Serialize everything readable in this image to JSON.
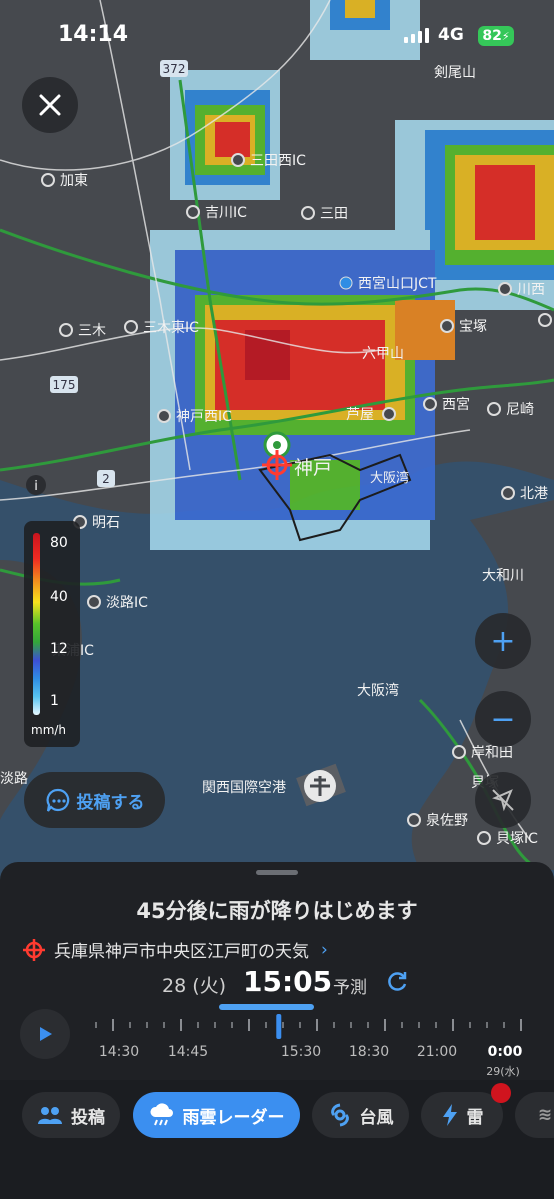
{
  "status_bar": {
    "time": "14:14",
    "network": "4G",
    "battery": "82"
  },
  "map": {
    "place_labels": [
      {
        "id": "kenbisan",
        "text": "剣尾山"
      },
      {
        "id": "sandanishi",
        "text": "三田西IC"
      },
      {
        "id": "kato",
        "text": "加東"
      },
      {
        "id": "yokawa",
        "text": "吉川IC"
      },
      {
        "id": "sanda",
        "text": "三田"
      },
      {
        "id": "nishinomiya_yamaguchi",
        "text": "西宮山口JCT"
      },
      {
        "id": "kawanishi",
        "text": "川西"
      },
      {
        "id": "miki",
        "text": "三木"
      },
      {
        "id": "mikihigashi",
        "text": "三木東IC"
      },
      {
        "id": "takarazuka",
        "text": "宝塚"
      },
      {
        "id": "rokkosan",
        "text": "六甲山"
      },
      {
        "id": "kobenishi",
        "text": "神戸西IC"
      },
      {
        "id": "ashiya",
        "text": "芦屋"
      },
      {
        "id": "nishinomiya",
        "text": "西宮"
      },
      {
        "id": "amagasaki",
        "text": "尼崎"
      },
      {
        "id": "kobe",
        "text": "神戸"
      },
      {
        "id": "osakawan_label1",
        "text": "大阪湾"
      },
      {
        "id": "kitakyu",
        "text": "北港"
      },
      {
        "id": "akashi",
        "text": "明石"
      },
      {
        "id": "yamatogawa",
        "text": "大和川"
      },
      {
        "id": "awaji",
        "text": "淡路IC"
      },
      {
        "id": "higashiura",
        "text": "東浦IC"
      },
      {
        "id": "osakawan_label2",
        "text": "大阪湾"
      },
      {
        "id": "kishiwada",
        "text": "岸和田"
      },
      {
        "id": "kaizuka",
        "text": "貝塚"
      },
      {
        "id": "kansai_airport",
        "text": "関西国際空港"
      },
      {
        "id": "awaji2",
        "text": "淡路"
      },
      {
        "id": "izumisano",
        "text": "泉佐野"
      },
      {
        "id": "kaizuka_ic",
        "text": "貝塚IC"
      }
    ],
    "route_labels": [
      "372",
      "175",
      "2"
    ],
    "colors": {
      "land": "#46494e",
      "sea": "#35506a",
      "expressway": "#2f9a3c",
      "road": "#e8e8e8"
    }
  },
  "legend": {
    "values": [
      "80",
      "40",
      "12",
      "1"
    ],
    "unit": "mm/h"
  },
  "post_button": {
    "label": "投稿する"
  },
  "zoom": {
    "in": "+",
    "out": "−"
  },
  "sheet": {
    "headline": "45分後に雨が降りはじめます",
    "location": "兵庫県神戸市中央区江戸町の天気",
    "date": "28 (火)",
    "time": "15:05",
    "mode": "予測",
    "timeline_labels": [
      "14:30",
      "14:45",
      "15:30",
      "18:30",
      "21:00",
      "0:00"
    ],
    "timeline_sublabel": "29(水)",
    "current_position": 0.42
  },
  "tabs": [
    {
      "label": "投稿",
      "icon": "people-icon",
      "active": false
    },
    {
      "label": "雨雲レーダー",
      "icon": "rain-cloud-icon",
      "active": true
    },
    {
      "label": "台風",
      "icon": "typhoon-icon",
      "active": false
    },
    {
      "label": "雷",
      "icon": "lightning-icon",
      "active": false
    }
  ],
  "accent_color": "#3b8ff0"
}
